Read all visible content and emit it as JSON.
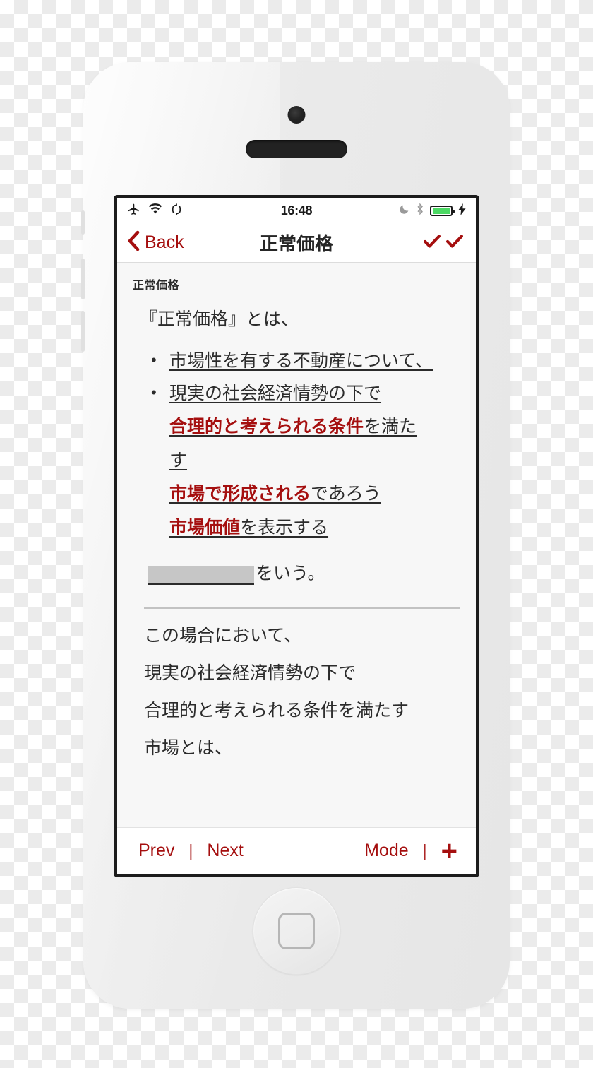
{
  "device": {
    "camera_icon": "camera-icon",
    "speaker_icon": "earpiece-speaker",
    "home_button_icon": "home-button-square"
  },
  "status_bar": {
    "time": "16:48",
    "left_icons": [
      "airplane-mode-icon",
      "wifi-icon",
      "sync-icon"
    ],
    "right_icons": [
      "do-not-disturb-moon-icon",
      "bluetooth-icon",
      "battery-icon",
      "charging-bolt-icon"
    ],
    "battery_level_percent": 100,
    "battery_color": "#4cd964"
  },
  "nav_bar": {
    "back_label": "Back",
    "title": "正常価格",
    "right_icons": [
      "checkmark-icon",
      "checkmark-icon"
    ],
    "accent_color": "#a50f0f"
  },
  "content": {
    "section_heading": "正常価格",
    "intro": "『正常価格』とは、",
    "bullets": [
      {
        "lines": [
          {
            "text": "市場性を有する不動産について、",
            "style": "underline"
          }
        ]
      },
      {
        "lines": [
          {
            "text": "現実の社会経済情勢の下で",
            "style": "underline"
          },
          {
            "highlight": "合理的と考えられる条件",
            "rest": "を満た",
            "style": "underline-highlight"
          },
          {
            "text": "す",
            "style": "underline"
          },
          {
            "highlight": "市場で形成される",
            "rest": "であろう",
            "style": "underline-highlight"
          },
          {
            "highlight": "市場価値",
            "rest": "を表示する",
            "style": "underline-highlight"
          }
        ]
      }
    ],
    "redacted": {
      "block_label": "hidden-answer-block",
      "trailing_text": "をいう。"
    },
    "tail_lines": [
      "この場合において、",
      "現実の社会経済情勢の下で",
      "合理的と考えられる条件を満たす",
      "市場とは、"
    ]
  },
  "toolbar": {
    "prev_label": "Prev",
    "separator": "|",
    "next_label": "Next",
    "mode_label": "Mode",
    "add_label": "+",
    "accent_color": "#a50f0f"
  }
}
